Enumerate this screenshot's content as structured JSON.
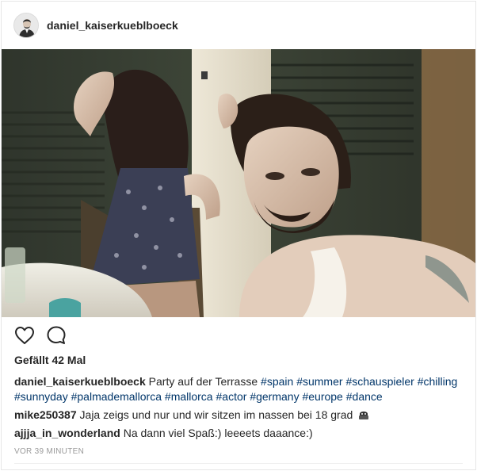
{
  "post": {
    "username": "daniel_kaiserkueblboeck",
    "likes_text": "Gefällt 42 Mal",
    "caption": {
      "username": "daniel_kaiserkueblboeck",
      "text": "Party auf der Terrasse",
      "hashtags": [
        "#spain",
        "#summer",
        "#schauspieler",
        "#chilling",
        "#sunnyday",
        "#palmademallorca",
        "#mallorca",
        "#actor",
        "#germany",
        "#europe",
        "#dance"
      ]
    },
    "comments": [
      {
        "username": "mike250387",
        "text": "Jaja zeigs und nur und wir sitzen im nassen bei 18 grad",
        "emoji": "sad-face-emoji"
      },
      {
        "username": "ajjja_in_wonderland",
        "text": "Na dann viel Spaß:) leeeets daaance:)"
      }
    ],
    "timestamp": "VOR 39 MINUTEN"
  },
  "icons": {
    "like": "heart-icon",
    "comment": "comment-bubble-icon"
  },
  "colors": {
    "hashtag": "#003569",
    "text": "#262626",
    "muted": "#999999",
    "border": "#e6e6e6"
  }
}
